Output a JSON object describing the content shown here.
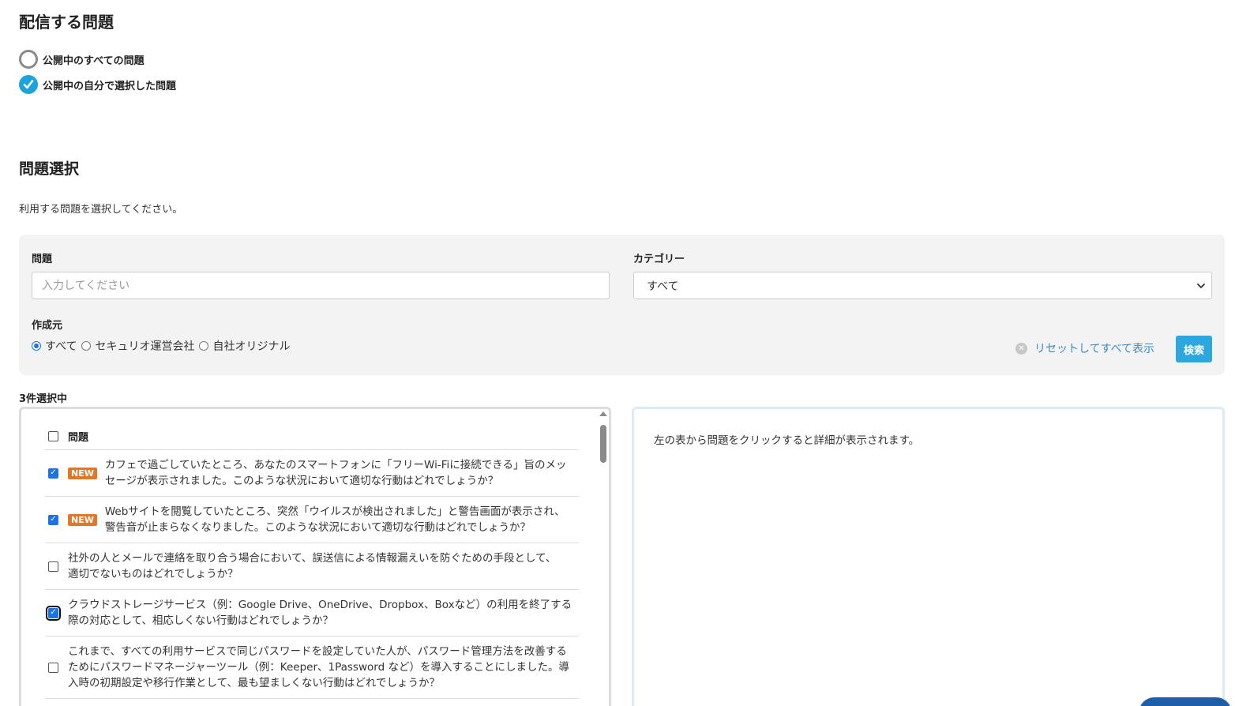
{
  "distribution": {
    "title": "配信する問題",
    "options": [
      {
        "label": "公開中のすべての問題",
        "selected": false
      },
      {
        "label": "公開中の自分で選択した問題",
        "selected": true
      }
    ]
  },
  "selection": {
    "title": "問題選択",
    "description": "利用する問題を選択してください。"
  },
  "filter": {
    "question_label": "問題",
    "question_placeholder": "入力してください",
    "question_value": "",
    "category_label": "カテゴリー",
    "category_value": "すべて",
    "source_label": "作成元",
    "source_options": [
      {
        "label": "すべて",
        "selected": true
      },
      {
        "label": "セキュリオ運営会社",
        "selected": false
      },
      {
        "label": "自社オリジナル",
        "selected": false
      }
    ],
    "reset_label": "リセットしてすべて表示",
    "search_label": "検索"
  },
  "selected_count": "3件選択中",
  "table": {
    "header_label": "問題",
    "rows": [
      {
        "checked": true,
        "badge": "NEW",
        "text": "カフェで過ごしていたところ、あなたのスマートフォンに「フリーWi-Fiに接続できる」旨のメッセージが表示されました。このような状況において適切な行動はどれでしょうか？"
      },
      {
        "checked": true,
        "badge": "NEW",
        "text": "Webサイトを閲覧していたところ、突然「ウイルスが検出されました」と警告画面が表示され、警告音が止まらなくなりました。このような状況において適切な行動はどれでしょうか？"
      },
      {
        "checked": false,
        "badge": "",
        "text": "社外の人とメールで連絡を取り合う場合において、誤送信による情報漏えいを防ぐための手段として、適切でないものはどれでしょうか？"
      },
      {
        "checked": true,
        "badge": "",
        "text": "クラウドストレージサービス（例：Google Drive、OneDrive、Dropbox、Boxなど）の利用を終了する際の対応として、相応しくない行動はどれでしょうか？"
      },
      {
        "checked": false,
        "badge": "",
        "text": "これまで、すべての利用サービスで同じパスワードを設定していた人が、パスワード管理方法を改善するためにパスワードマネージャーツール（例：Keeper、1Password など）を導入することにしました。導入時の初期設定や移行作業として、最も望ましくない行動はどれでしょうか？"
      }
    ]
  },
  "detail": {
    "placeholder": "左の表から問題をクリックすると詳細が表示されます。"
  },
  "colors": {
    "accent": "#2ea7df",
    "new_badge": "#e0782a",
    "link": "#3b8bc9",
    "checkbox": "#1a73e8"
  }
}
